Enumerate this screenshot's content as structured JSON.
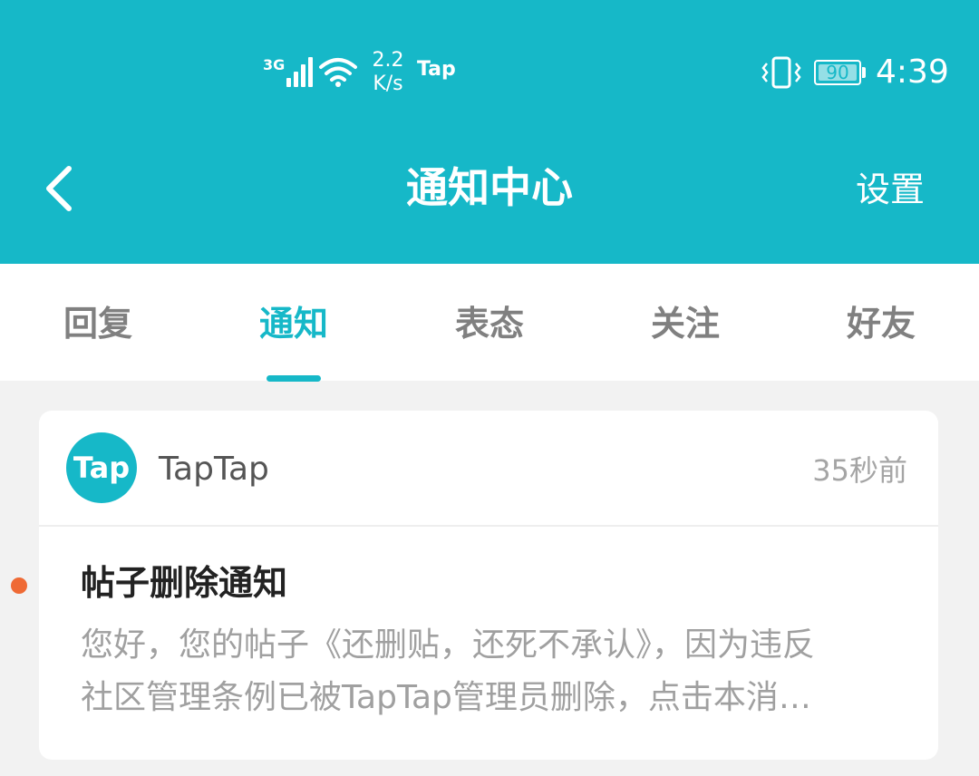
{
  "status_bar": {
    "network_type": "3G",
    "speed_value": "2.2",
    "speed_unit": "K/s",
    "app_indicator": "Tap",
    "battery_level": "90",
    "time": "4:39",
    "icons": [
      "signal-icon",
      "wifi-icon",
      "vibrate-icon",
      "battery-icon"
    ]
  },
  "header": {
    "title": "通知中心",
    "settings_label": "设置",
    "back_icon": "chevron-left-icon"
  },
  "tabs": [
    {
      "label": "回复",
      "active": false
    },
    {
      "label": "通知",
      "active": true
    },
    {
      "label": "表态",
      "active": false
    },
    {
      "label": "关注",
      "active": false
    },
    {
      "label": "好友",
      "active": false
    }
  ],
  "notification": {
    "avatar_text": "Tap",
    "sender": "TapTap",
    "time": "35秒前",
    "unread": true,
    "title": "帖子删除通知",
    "body_line1": "您好，您的帖子《还删贴，还死不承认》，因为违反",
    "body_line2": "社区管理条例已被TapTap管理员删除，点击本消…"
  },
  "colors": {
    "accent": "#16b8c8",
    "unread_dot": "#ef6a35",
    "background": "#f2f2f2"
  }
}
